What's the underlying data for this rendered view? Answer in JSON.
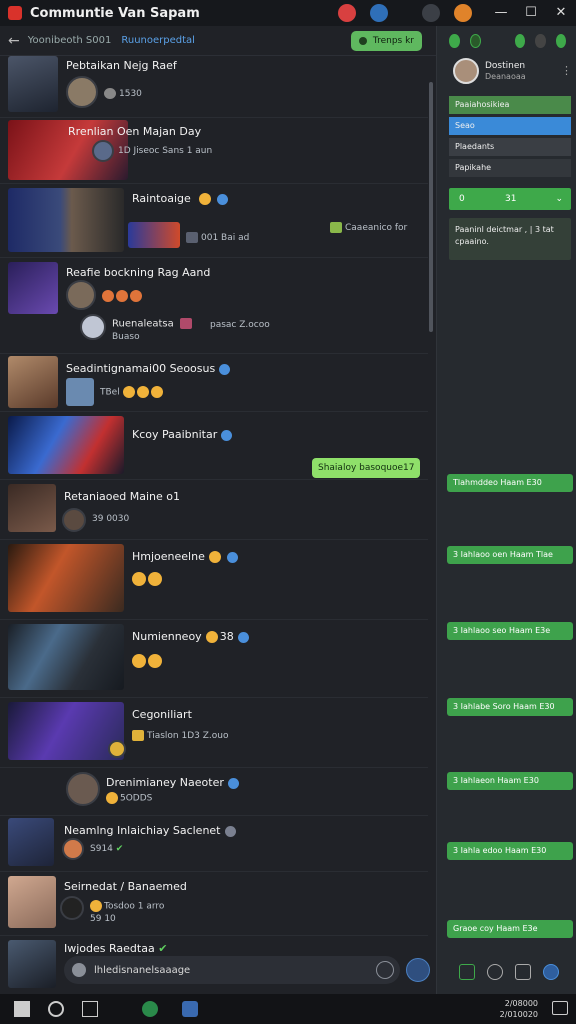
{
  "window": {
    "title": "Communtie Van Sapam",
    "controls": {
      "minimize": "—",
      "maximize": "☐",
      "close": "✕"
    },
    "top_icons": [
      "record-icon",
      "chat-icon",
      "gamepad-icon",
      "fire-icon"
    ]
  },
  "chat_header": {
    "back": "←",
    "label_a": "Yoonibeoth S001",
    "label_b": "Ruunoerpedtal",
    "pill": "Trenps kr"
  },
  "messages": [
    {
      "title": "Pebtaikan Nejg Raef",
      "sub": "1530"
    },
    {
      "title": "Rrenlian Oen Majan Day",
      "sub": "1D Jiseoc   Sans   1 aun"
    },
    {
      "title": "Raintoaige",
      "sub": "001 Bai ad",
      "side": "Caaeanico for"
    },
    {
      "title": "Reafie bockning Rag Aand",
      "sub": ""
    },
    {
      "title": "Ruenaleatsa",
      "sub": "pasac  Z.ocoo",
      "sub2": "Buaso"
    },
    {
      "title": "Seadintignamai00 Seoosus",
      "sub": "TBel"
    },
    {
      "title": "Kcoy Paaibnitar",
      "bubble": "Shaialoy basoquoe17"
    },
    {
      "title": "Retaniaoed Maine o1",
      "sub": "39 0030"
    },
    {
      "title": "Hmjoeneelne",
      "sub": ""
    },
    {
      "title": "Numienneoy",
      "sub": "38"
    },
    {
      "title": "Cegoniliart",
      "sub": "Tiaslon   1D3   Z.ouo"
    },
    {
      "title": "Drenimianey Naeoter",
      "sub": "5ODDS"
    },
    {
      "title": "Neamlng Inlaichiay Saclenet",
      "sub": "S914"
    },
    {
      "title": "Seirnedat / Banaemed",
      "sub": "Tosdoo   1 arro",
      "sub2": "59 10"
    },
    {
      "title": "Iwjodes Raedtaa",
      "sub": ""
    }
  ],
  "composer": {
    "value": "lhledisnanelsaaage"
  },
  "right_panel": {
    "profile_name": "Dostinen",
    "profile_sub": "Deanaoaa",
    "tabs": [
      "Paaiahosikiea",
      "Seao",
      "Plaedants",
      "Papikahe"
    ],
    "select": {
      "left": "0",
      "mid": "31",
      "arrow": "⌄"
    },
    "note": "Paaninl deictmar , | 3 tat cpaaino.",
    "bubbles": [
      "Tlahmddeo Haam  E30",
      "3 Iahlaoo oen Haam  Tlae",
      "3 Iahlaoo seo Haam  E3e",
      "3 Iahlabe Soro Haam  E30",
      "3 Iahlaeon Haam  E30",
      "3 Iahla edoo Haam  E30",
      "Graoe coy Haam  E3e"
    ]
  },
  "taskbar": {
    "clock_time": "2/08000",
    "clock_date": "2/010020"
  }
}
